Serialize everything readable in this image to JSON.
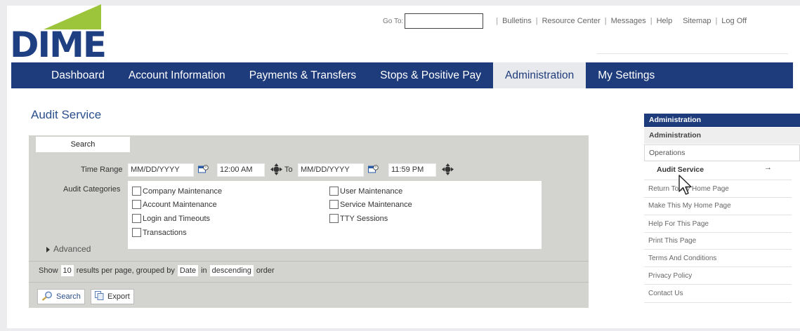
{
  "brand": {
    "logo_text": "DIME",
    "logo_green": "#9cc53b",
    "logo_blue": "#1e3f82"
  },
  "topnav": {
    "goto_label": "Go To:",
    "goto_value": "",
    "links": [
      "Bulletins",
      "Resource Center",
      "Messages",
      "Help",
      "Sitemap",
      "Log Off"
    ]
  },
  "mainnav": {
    "tabs": [
      "Dashboard",
      "Account Information",
      "Payments & Transfers",
      "Stops & Positive Pay",
      "Administration",
      "My Settings"
    ],
    "active": "Administration",
    "color": "#1e3c7b"
  },
  "page": {
    "title": "Audit Service",
    "tab": "Search"
  },
  "form": {
    "time_range_label": "Time Range",
    "from_date": "MM/DD/YYYY",
    "from_time": "12:00 AM",
    "to_label": "To",
    "to_date": "MM/DD/YYYY",
    "to_time": "11:59 PM",
    "categories_label": "Audit Categories",
    "categories": [
      "Company Maintenance",
      "Account Maintenance",
      "Login and Timeouts",
      "Transactions",
      "User Maintenance",
      "Service Maintenance",
      "TTY Sessions"
    ],
    "advanced_label": "Advanced",
    "results": {
      "show": "Show",
      "per_page": "10",
      "middle": "results per page, grouped by",
      "group_by": "Date",
      "in": "in",
      "order": "descending",
      "order_word": "order"
    },
    "search_button": "Search",
    "export_button": "Export"
  },
  "sidebar": {
    "header": "Administration",
    "sub": "Administration",
    "operations": "Operations",
    "active_item": "Audit Service",
    "active_mark": "→",
    "links": [
      "Return To My Home Page",
      "Make This My Home Page",
      "Help For This Page",
      "Print This Page",
      "Terms And Conditions",
      "Privacy Policy",
      "Contact Us"
    ]
  }
}
